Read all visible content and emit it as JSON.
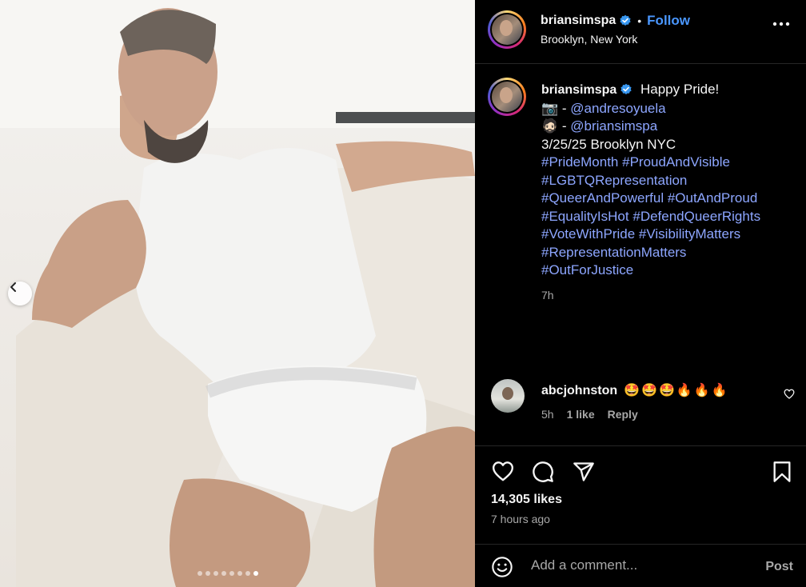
{
  "post": {
    "username": "briansimspa",
    "follow_label": "Follow",
    "separator": "•",
    "location": "Brooklyn, New York"
  },
  "caption": {
    "first_line": "Happy Pride!",
    "credit_photo_emoji": "📷",
    "credit_photo_sep": " - ",
    "credit_photo_handle": "@andresoyuela",
    "credit_model_emoji": "🧔🏻",
    "credit_model_sep": " - ",
    "credit_model_handle": "@briansimspa",
    "date_line": "3/25/25 Brooklyn NYC",
    "hashtag_lines": [
      [
        "#PrideMonth",
        "#ProudAndVisible"
      ],
      [
        "#LGBTQRepresentation"
      ],
      [
        "#QueerAndPowerful",
        "#OutAndProud"
      ],
      [
        "#EqualityIsHot",
        "#DefendQueerRights"
      ],
      [
        "#VoteWithPride",
        "#VisibilityMatters"
      ],
      [
        "#RepresentationMatters"
      ],
      [
        "#OutForJustice"
      ]
    ],
    "age": "7h"
  },
  "comment": {
    "username": "abcjohnston",
    "emojis": "🤩🤩🤩🔥🔥🔥",
    "age": "5h",
    "likes": "1 like",
    "reply_label": "Reply"
  },
  "stats": {
    "likes": "14,305 likes",
    "posted": "7 hours ago"
  },
  "composer": {
    "placeholder": "Add a comment...",
    "post_label": "Post"
  },
  "carousel": {
    "total_slides": 8,
    "active_slide": 8
  },
  "colors": {
    "background": "#000000",
    "text": "#f5f5f5",
    "muted": "#a8a8a8",
    "link": "#8da6ff",
    "follow": "#4a97ff",
    "verified": "#3897f0",
    "divider": "#262626"
  },
  "icons": {
    "more": "more-options-icon",
    "verified": "verified-badge-icon",
    "like": "heart-icon",
    "comment": "comment-icon",
    "share": "share-icon",
    "save": "bookmark-icon",
    "emoji": "emoji-icon",
    "prev": "chevron-left-icon"
  }
}
